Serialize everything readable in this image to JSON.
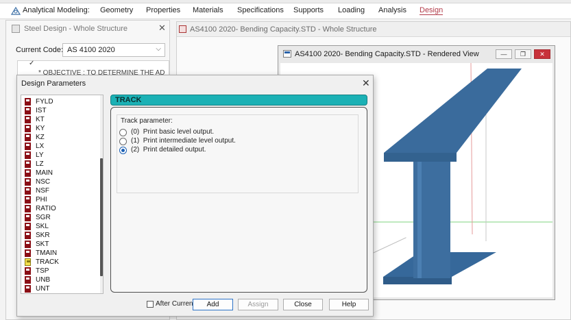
{
  "ribbon": {
    "tabs": [
      {
        "label": "Analytical Modeling:"
      },
      {
        "label": "Geometry"
      },
      {
        "label": "Properties"
      },
      {
        "label": "Materials"
      },
      {
        "label": "Specifications"
      },
      {
        "label": "Supports"
      },
      {
        "label": "Loading"
      },
      {
        "label": "Analysis"
      },
      {
        "label": "Design"
      }
    ],
    "active_tab": "Design"
  },
  "steel_panel": {
    "title": "Steel Design - Whole Structure",
    "current_code_label": "Current Code:",
    "current_code_value": "AS 4100 2020",
    "objective_text": "* OBJECTIVE : TO DETERMINE THE AD"
  },
  "main_window": {
    "title": "AS4100 2020- Bending Capacity.STD - Whole Structure"
  },
  "rendered_view": {
    "title": "AS4100 2020- Bending Capacity.STD - Rendered View",
    "beam_color": "#3d6e9f"
  },
  "design_params": {
    "title": "Design Parameters",
    "params": [
      "FYLD",
      "IST",
      "KT",
      "KY",
      "KZ",
      "LX",
      "LY",
      "LZ",
      "MAIN",
      "NSC",
      "NSF",
      "PHI",
      "RATIO",
      "SGR",
      "SKL",
      "SKR",
      "SKT",
      "TMAIN",
      "TRACK",
      "TSP",
      "UNB",
      "UNT"
    ],
    "selected_param": "TRACK",
    "section_header": "TRACK",
    "group_label": "Track parameter:",
    "options": [
      {
        "code": "(0)",
        "label": "Print basic level output.",
        "selected": false
      },
      {
        "code": "(1)",
        "label": "Print intermediate level output.",
        "selected": false
      },
      {
        "code": "(2)",
        "label": "Print detailed output.",
        "selected": true
      }
    ],
    "after_current_label": "After Current",
    "buttons": {
      "add": "Add",
      "assign": "Assign",
      "close": "Close",
      "help": "Help"
    }
  }
}
